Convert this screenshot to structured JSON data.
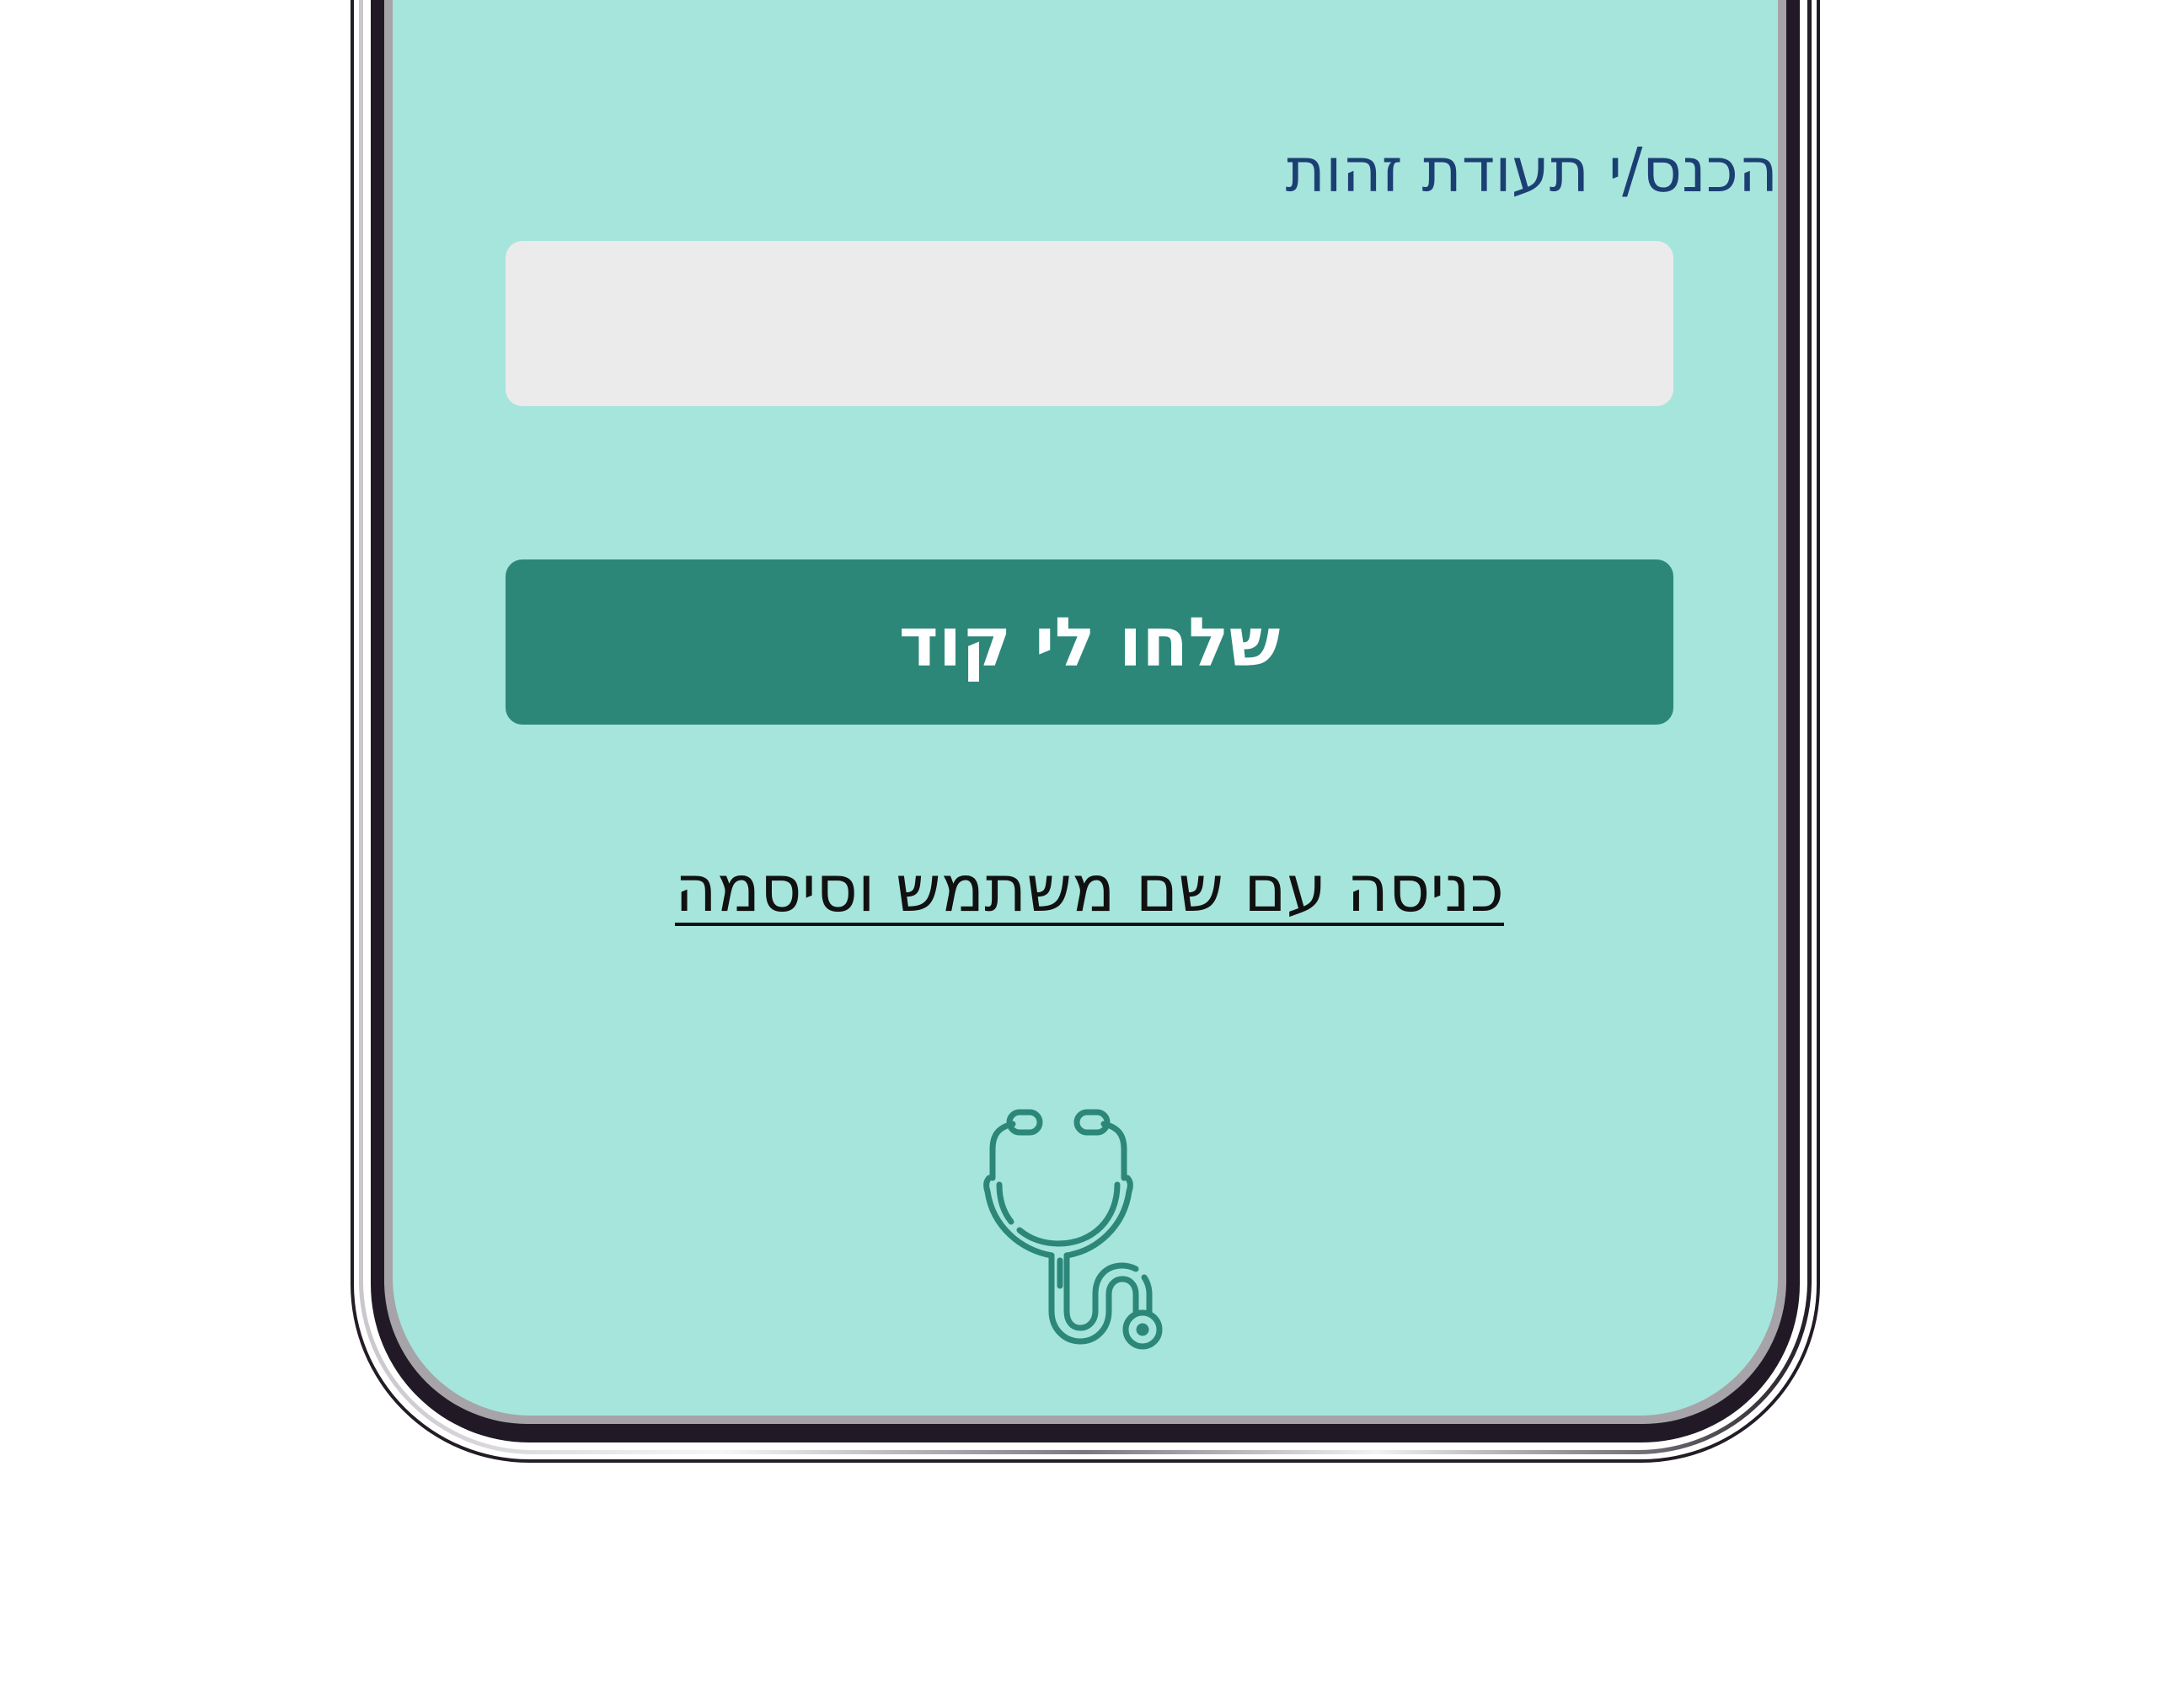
{
  "login": {
    "id_label": "הכנס/י תעודת זהות",
    "id_input_value": "",
    "id_input_placeholder": "",
    "send_button_label": "שלחו לי קוד",
    "alt_login_link": "כניסה עם שם משתמש וסיסמה"
  },
  "icons": {
    "bottom_icon": "stethoscope-icon"
  },
  "colors": {
    "screen_background": "#a6e5dc",
    "label_text": "#1c3f73",
    "input_background": "#ebebeb",
    "button_background": "#2c8779",
    "button_text": "#ffffff",
    "icon_color": "#2c8779"
  }
}
